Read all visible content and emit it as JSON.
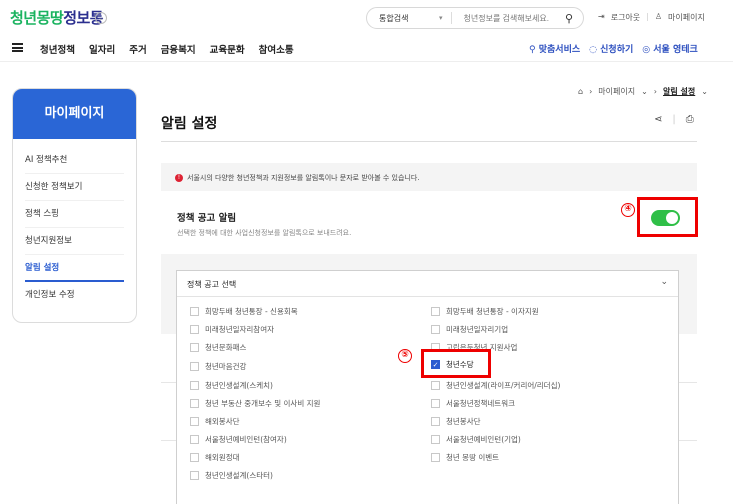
{
  "header": {
    "logo_part1": "청년몽땅",
    "logo_part2": "정보통",
    "search_scope": "통합검색",
    "search_placeholder": "청년정보를 검색해보세요.",
    "util": [
      "로그아웃",
      "마이페이지"
    ]
  },
  "nav": {
    "menu": [
      "청년정책",
      "일자리",
      "주거",
      "금융복지",
      "교육문화",
      "참여소통"
    ],
    "quick": [
      "맞춤서비스",
      "신청하기",
      "서울 영테크"
    ]
  },
  "sidebar": {
    "title": "마이페이지",
    "items": [
      "AI 정책추천",
      "신청한 정책보기",
      "정책 스핑",
      "청년지원정보",
      "알림 설정",
      "개인정보 수정"
    ],
    "active_index": 4
  },
  "breadcrumb": [
    "마이페이지",
    "알림 설정"
  ],
  "page": {
    "title": "알림 설정",
    "notice": "서울시의 다양한 청년정책과 지원정보를 알림톡이나 문자로 받아볼 수 있습니다.",
    "setting_title": "정책 공고 알림",
    "setting_desc": "선택한 정책에 대한 사업신청정보를 알림톡으로 보내드려요.",
    "toggle_on": true,
    "annotation_4": "④",
    "annotation_5": "⑤"
  },
  "dropdown": {
    "label": "정책 공고 선택",
    "options_left": [
      "희망두배 청년통장 - 신용회복",
      "미래청년일자리참여자",
      "청년문화패스",
      "청년마음건강",
      "청년인생설계(스케치)",
      "청년 부동산 중개보수 및 이사비 지원",
      "해외봉사단",
      "서울청년예비인턴(참여자)",
      "해외원정대",
      "청년인생설계(스타터)"
    ],
    "options_right": [
      "희망두배 청년통장 - 이자지원",
      "미래청년일자리기업",
      "고립은둔청년 지원사업",
      "청년수당",
      "청년인생설계(라이프/커리어/리더십)",
      "서울청년정책네트워크",
      "청년봉사단",
      "서울청년예비인턴(기업)",
      "청년 몽땅 이벤트"
    ],
    "selected": "청년수당"
  },
  "colors": {
    "brand_blue": "#2a66d6",
    "toggle_green": "#2fbf47",
    "highlight_red": "#e00000"
  }
}
